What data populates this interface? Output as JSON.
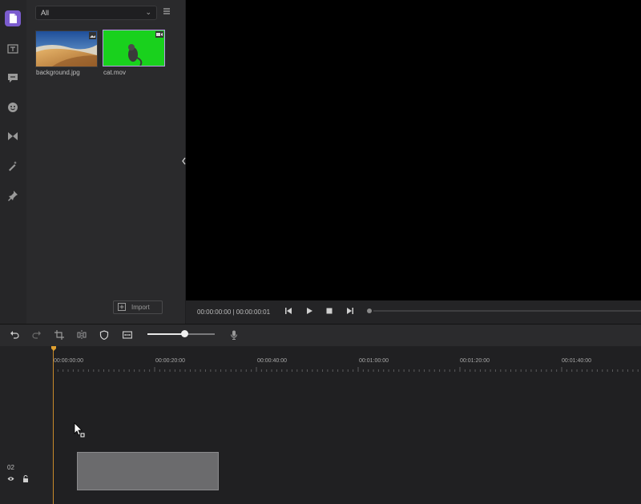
{
  "sidebar": {
    "icons": [
      "media-icon",
      "text-icon",
      "subtitle-icon",
      "sticker-icon",
      "transition-icon",
      "effects-icon",
      "pin-icon"
    ]
  },
  "media_panel": {
    "filter_value": "All",
    "items": [
      {
        "name": "background.jpg"
      },
      {
        "name": "cat.mov"
      }
    ],
    "import_label": "Import"
  },
  "player": {
    "timecode": "00:00:00:00 | 00:00:00:01"
  },
  "toolbar": {
    "zoom_level": 0.55
  },
  "timeline": {
    "ruler_labels": [
      "00:00:00:00",
      "00:00:20:00",
      "00:00:40:00",
      "00:01:00:00",
      "00:01:20:00",
      "00:01:40:00"
    ],
    "track_label": "02"
  },
  "colors": {
    "accent": "#7b5ccf",
    "playhead": "#c98a2a",
    "green_screen": "#19d11d"
  }
}
